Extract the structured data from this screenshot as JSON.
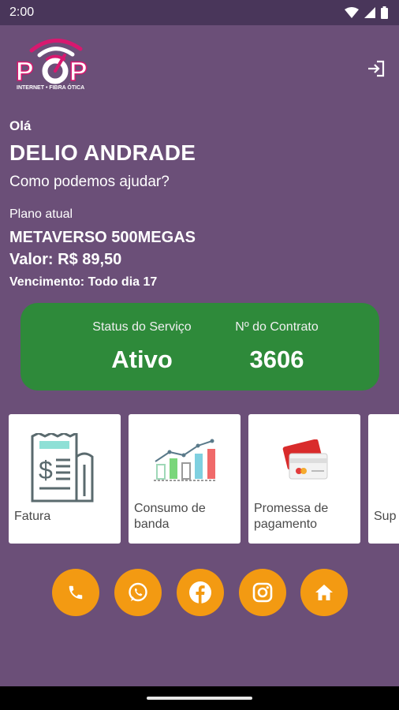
{
  "status_bar": {
    "time": "2:00",
    "icons": [
      "wifi-icon",
      "signal-icon",
      "battery-icon"
    ]
  },
  "header": {
    "logo": {
      "text": "POP",
      "tagline": "INTERNET • FIBRA ÓTICA"
    },
    "logout_icon": "logout-icon"
  },
  "greeting": {
    "hello": "Olá",
    "name": "DELIO ANDRADE",
    "help": "Como podemos ajudar?"
  },
  "plan": {
    "label": "Plano atual",
    "name": "METAVERSO 500MEGAS",
    "value": "Valor: R$ 89,50",
    "due": "Vencimento: Todo dia 17"
  },
  "status_card": {
    "service_label": "Status do Serviço",
    "service_value": "Ativo",
    "contract_label": "Nº do Contrato",
    "contract_value": "3606"
  },
  "tiles": [
    {
      "label": "Fatura",
      "icon": "invoice-icon"
    },
    {
      "label": "Consumo de banda",
      "icon": "bandwidth-chart-icon"
    },
    {
      "label": "Promessa de pagamento",
      "icon": "credit-card-icon"
    },
    {
      "label": "Sup",
      "icon": "support-icon"
    }
  ],
  "social": [
    {
      "name": "phone",
      "icon": "phone-icon"
    },
    {
      "name": "whatsapp",
      "icon": "whatsapp-icon"
    },
    {
      "name": "facebook",
      "icon": "facebook-icon"
    },
    {
      "name": "instagram",
      "icon": "instagram-icon"
    },
    {
      "name": "home",
      "icon": "home-icon"
    }
  ],
  "colors": {
    "background": "#6b4f78",
    "status_bar": "#49365a",
    "card_green": "#2e8a3a",
    "accent_orange": "#f39a12",
    "logo_pink": "#d8186f"
  }
}
